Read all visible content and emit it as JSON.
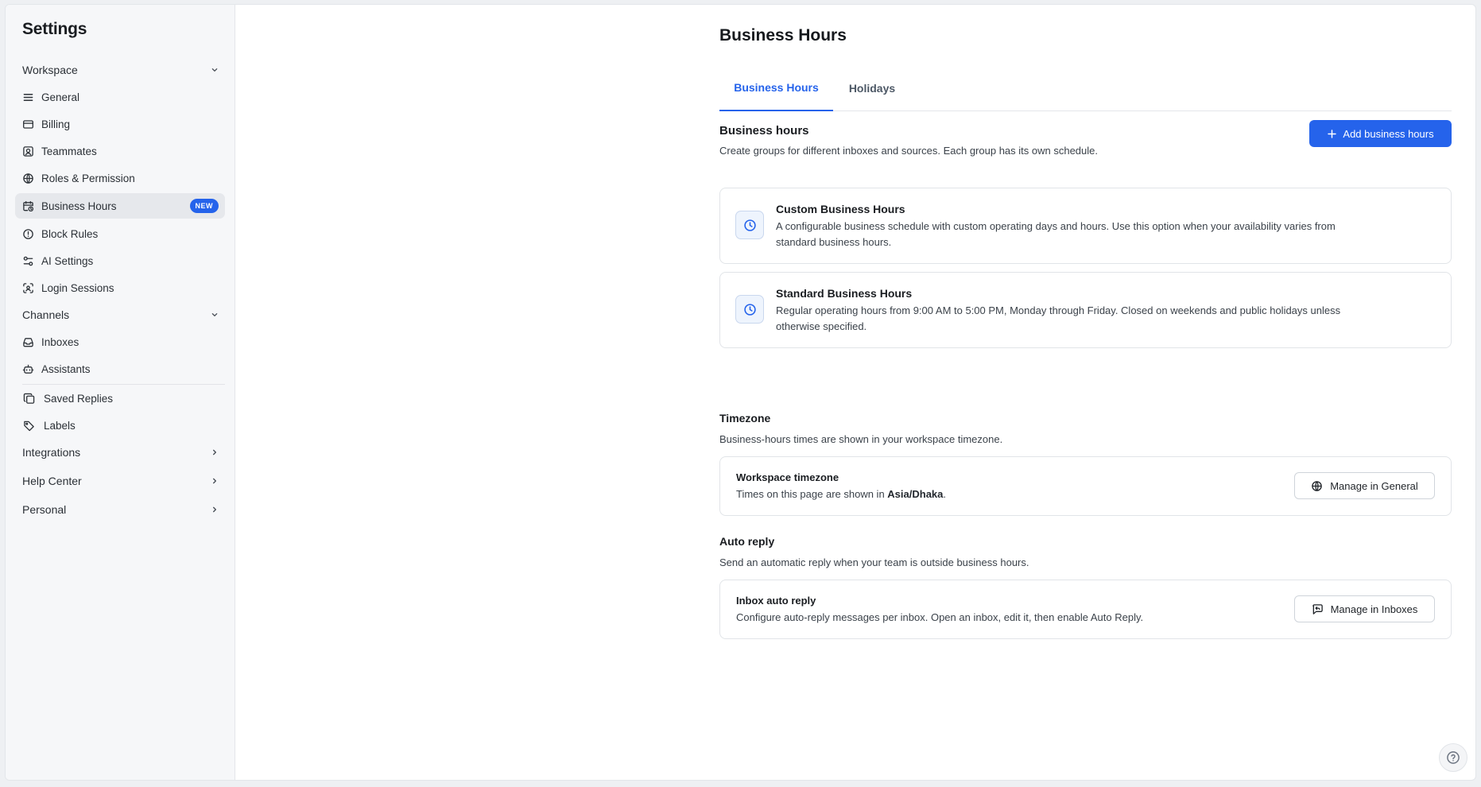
{
  "sidebar": {
    "title": "Settings",
    "workspace_label": "Workspace",
    "channels_label": "Channels",
    "integrations_label": "Integrations",
    "help_center_label": "Help Center",
    "personal_label": "Personal",
    "items": {
      "general": "General",
      "billing": "Billing",
      "teammates": "Teammates",
      "roles": "Roles & Permission",
      "business_hours": "Business Hours",
      "block_rules": "Block Rules",
      "ai_settings": "AI Settings",
      "login_sessions": "Login Sessions",
      "inboxes": "Inboxes",
      "assistants": "Assistants",
      "saved_replies": "Saved Replies",
      "labels": "Labels"
    },
    "new_badge": "NEW"
  },
  "page": {
    "title": "Business Hours",
    "tabs": [
      "Business Hours",
      "Holidays"
    ]
  },
  "business_hours": {
    "title": "Business hours",
    "description": "Create groups for different inboxes and sources. Each group has its own schedule.",
    "add_button": "Add business hours",
    "cards": [
      {
        "title": "Custom Business Hours",
        "description": "A configurable business schedule with custom operating days and hours. Use this option when your availability varies from standard business hours."
      },
      {
        "title": "Standard Business Hours",
        "description": "Regular operating hours from 9:00 AM to 5:00 PM, Monday through Friday. Closed on weekends and public holidays unless otherwise specified."
      }
    ]
  },
  "timezone": {
    "title": "Timezone",
    "description": "Business-hours times are shown in your workspace timezone.",
    "card_title": "Workspace timezone",
    "card_desc_prefix": "Times on this page are shown in ",
    "card_desc_value": "Asia/Dhaka",
    "card_desc_suffix": ".",
    "button": "Manage in General"
  },
  "auto_reply": {
    "title": "Auto reply",
    "description": "Send an automatic reply when your team is outside business hours.",
    "card_title": "Inbox auto reply",
    "card_desc": "Configure auto-reply messages per inbox. Open an inbox, edit it, then enable Auto Reply.",
    "button": "Manage in Inboxes"
  },
  "colors": {
    "accent": "#2563eb",
    "sidebar_bg": "#f6f7f9",
    "active_item_bg": "#e6e8ec"
  }
}
